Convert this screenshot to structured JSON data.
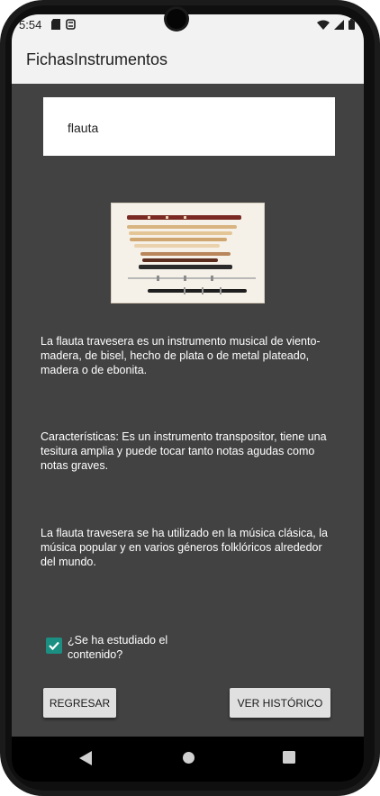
{
  "status_bar": {
    "time": "5:54",
    "left_icons": [
      "sd-card-icon",
      "sync-icon"
    ],
    "right_icons": [
      "wifi-icon",
      "cell-signal-icon",
      "battery-icon"
    ]
  },
  "app_bar": {
    "title": "FichasInstrumentos"
  },
  "instrument_field": {
    "value": "flauta"
  },
  "image": {
    "subject": "flute-collection-image"
  },
  "paragraphs": {
    "description": "La flauta travesera es un instrumento musical de viento-madera, de bisel, hecho de plata o de metal plateado, madera o de ebonita.",
    "characteristics": "Características: Es un instrumento transpositor, tiene una tesitura amplia y puede tocar tanto notas agudas como notas graves.",
    "usage": "La flauta travesera se ha utilizado en la música clásica, la música popular y en varios géneros folklóricos alrededor del mundo."
  },
  "studied_checkbox": {
    "label": "¿Se ha estudiado el contenido?",
    "checked": true,
    "color": "#1a8f82"
  },
  "buttons": {
    "back_label": "REGRESAR",
    "history_label": "VER HISTÓRICO"
  },
  "nav_bar": {
    "items": [
      "back-icon",
      "home-icon",
      "recents-icon"
    ]
  },
  "colors": {
    "background": "#424242",
    "app_bar": "#f2f2f2",
    "button": "#e0e0e0"
  }
}
